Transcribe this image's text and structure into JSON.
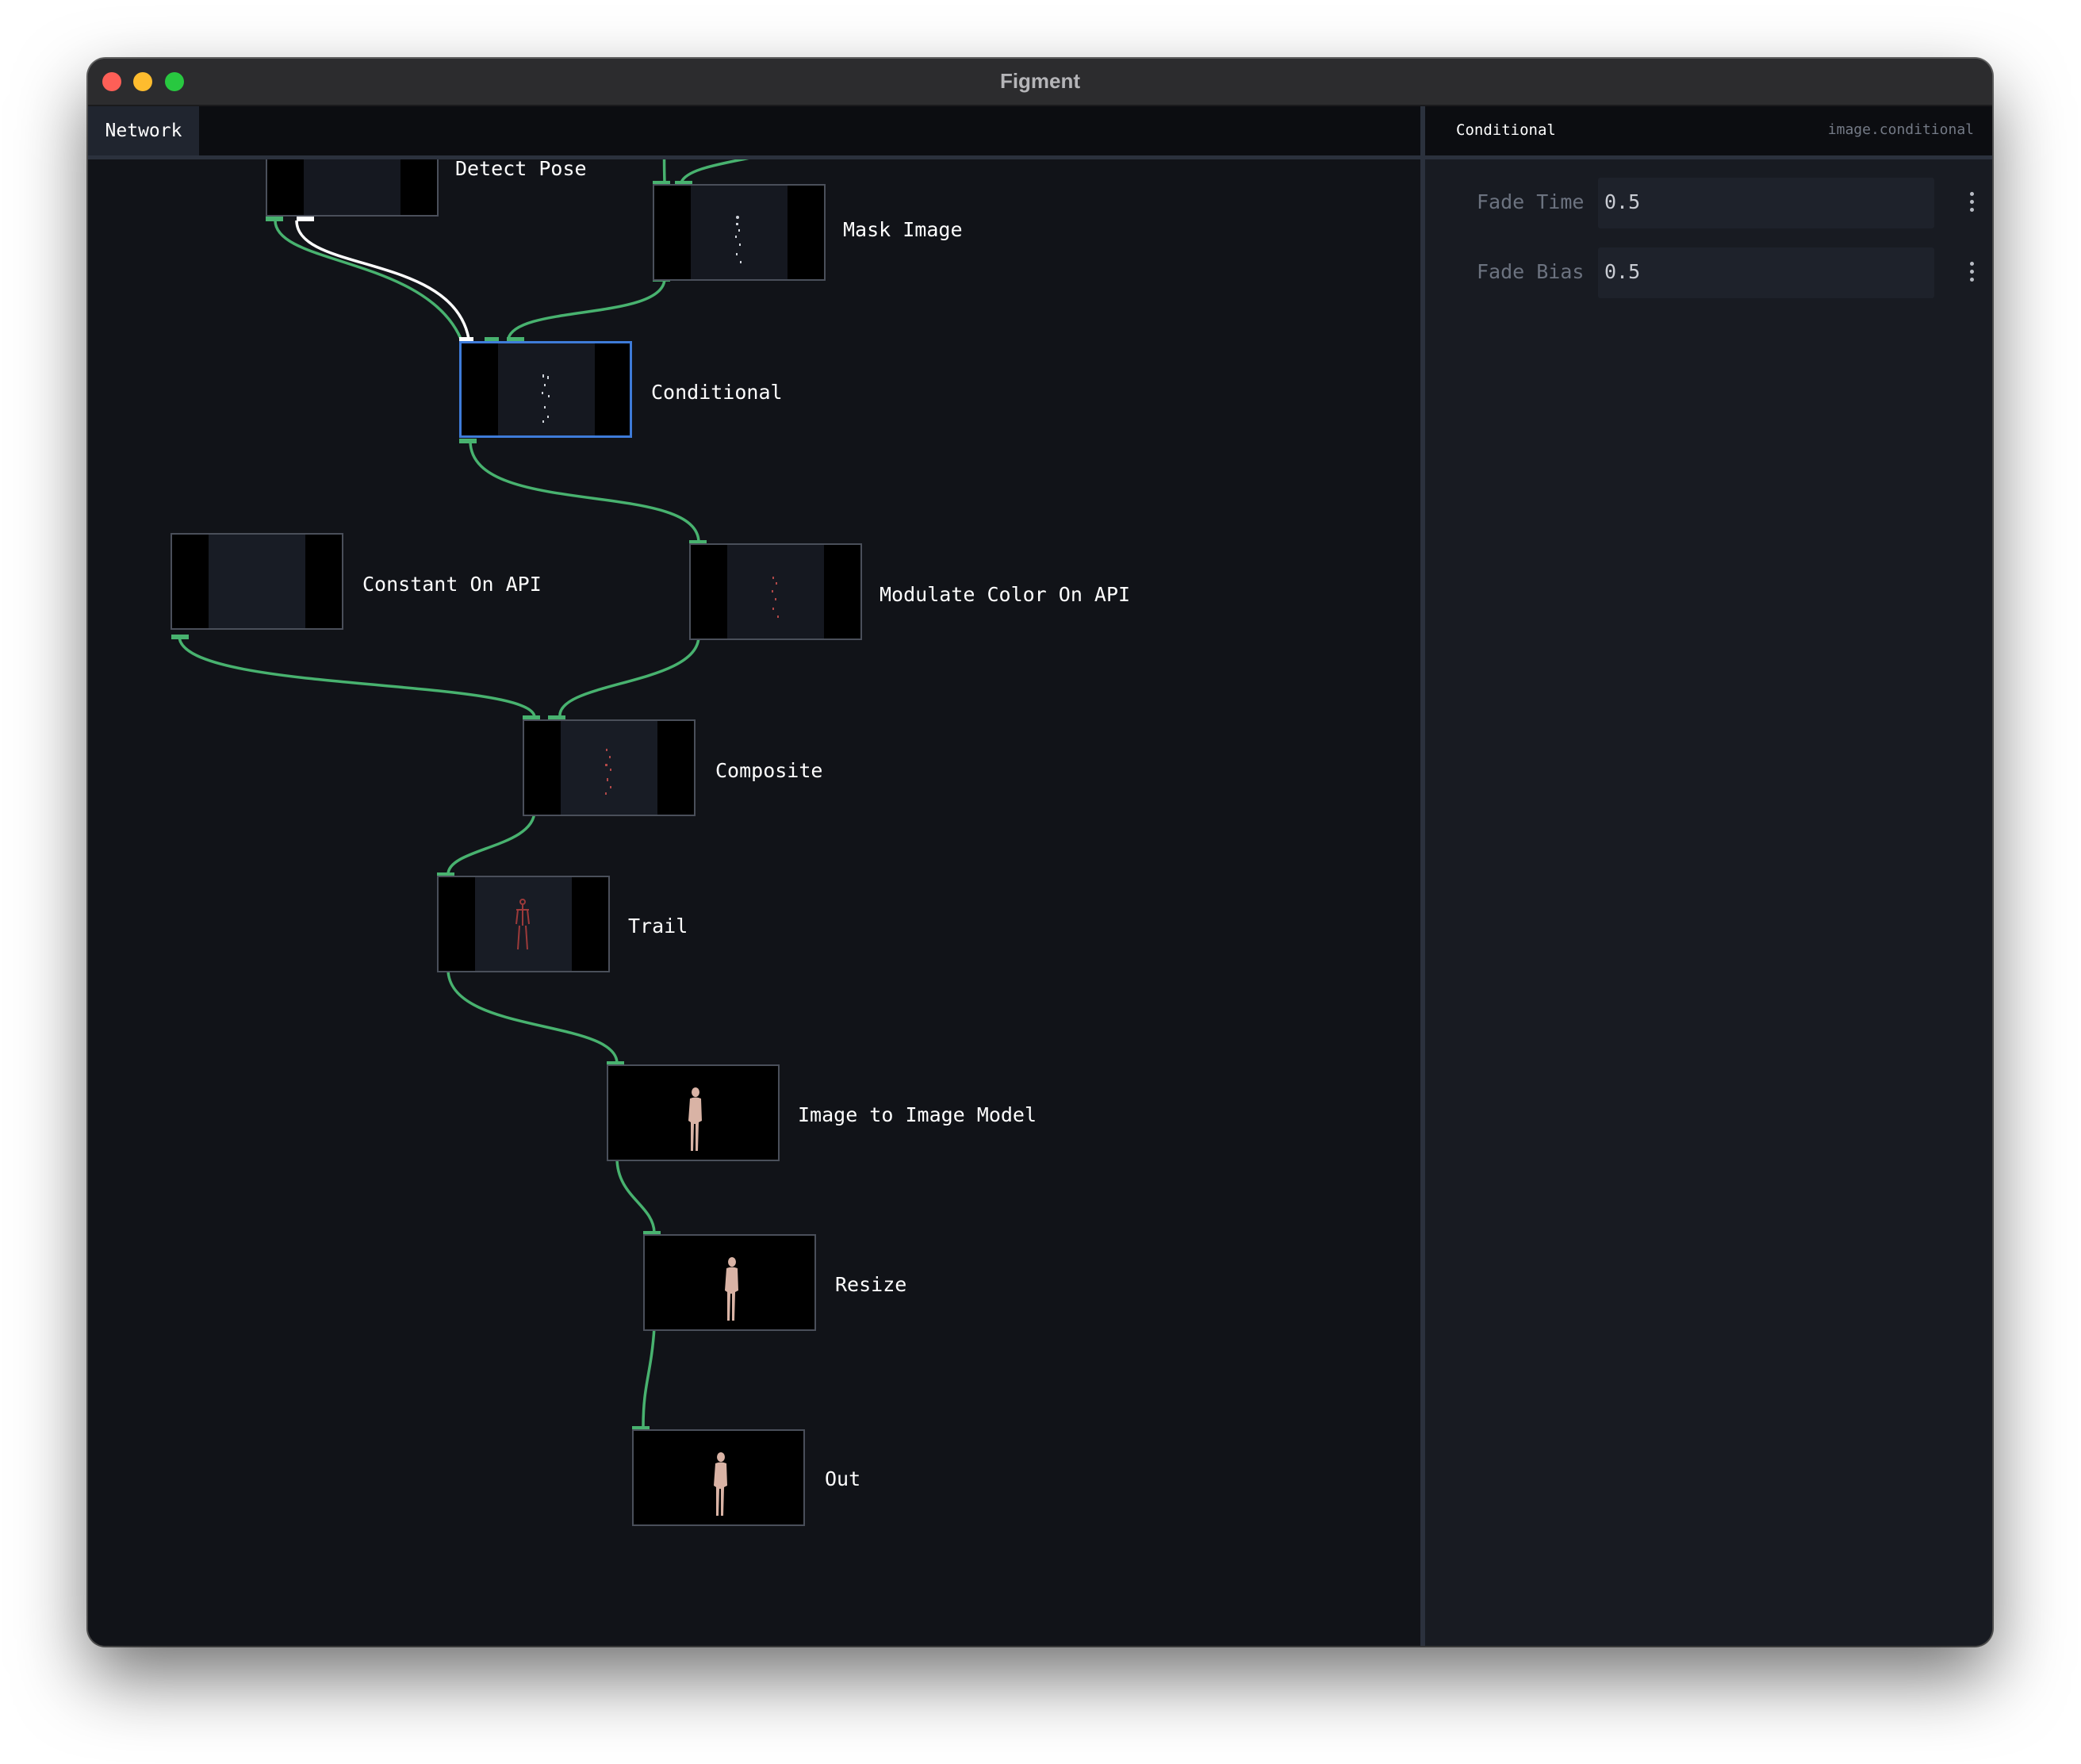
{
  "window": {
    "title": "Figment"
  },
  "tabs": [
    {
      "label": "Network",
      "active": true
    }
  ],
  "colors": {
    "wire": "#48b26f",
    "wire_active": "#ffffff",
    "selection": "#3e7bd8",
    "canvas_bg": "#111318"
  },
  "nodes": [
    {
      "id": "detect-pose",
      "label": "Detect Pose"
    },
    {
      "id": "mask-image",
      "label": "Mask Image"
    },
    {
      "id": "conditional",
      "label": "Conditional",
      "selected": true
    },
    {
      "id": "constant-on-api",
      "label": "Constant On API"
    },
    {
      "id": "modulate-color-on-api",
      "label": "Modulate Color On API"
    },
    {
      "id": "composite",
      "label": "Composite"
    },
    {
      "id": "trail",
      "label": "Trail"
    },
    {
      "id": "image-to-image-model",
      "label": "Image to Image Model"
    },
    {
      "id": "resize",
      "label": "Resize"
    },
    {
      "id": "out",
      "label": "Out"
    }
  ],
  "inspector": {
    "title": "Conditional",
    "type": "image.conditional",
    "params": [
      {
        "label": "Fade Time",
        "value": "0.5",
        "menu_icon": "more-vertical-icon"
      },
      {
        "label": "Fade Bias",
        "value": "0.5",
        "menu_icon": "more-vertical-icon"
      }
    ]
  }
}
